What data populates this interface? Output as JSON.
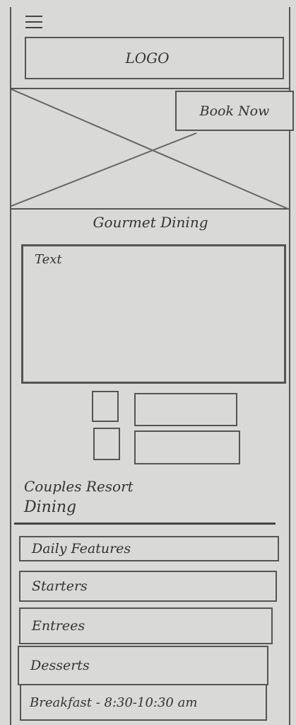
{
  "header": {
    "menu_icon": "hamburger-icon",
    "logo": "LOGO"
  },
  "hero": {
    "image_placeholder": "image-placeholder-x",
    "book_now": "Book Now"
  },
  "section": {
    "title": "Gourmet Dining",
    "text_placeholder": "Text"
  },
  "options": [
    {
      "checkbox": false
    },
    {
      "checkbox": false
    }
  ],
  "menu": {
    "title_line1": "Couples Resort",
    "title_line2": "Dining",
    "items": [
      "Daily Features",
      "Starters",
      "Entrees",
      "Desserts",
      "Breakfast - 8:30-10:30 am"
    ]
  }
}
